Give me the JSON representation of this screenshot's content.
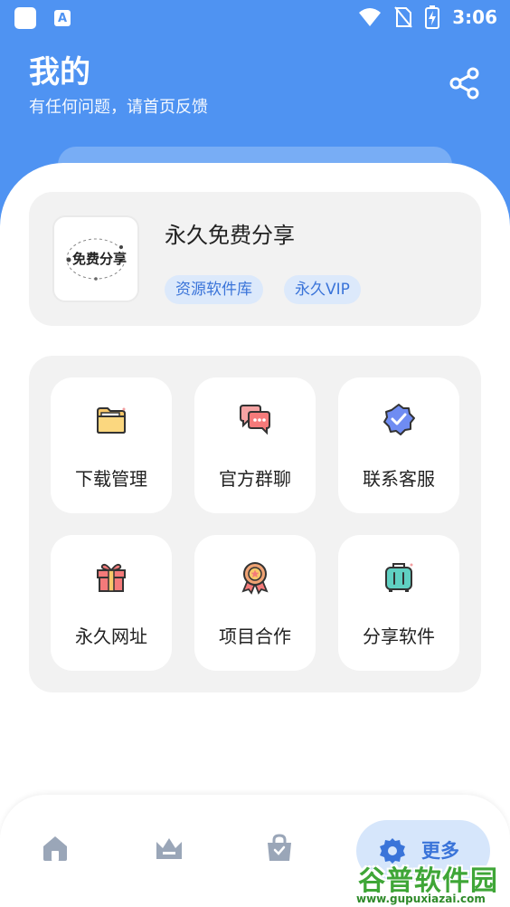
{
  "status_bar": {
    "time": "3:06",
    "notification_letter": "A"
  },
  "header": {
    "title": "我的",
    "subtitle": "有任何问题，请首页反馈",
    "share_icon": "share-icon"
  },
  "profile": {
    "avatar_text": "免费分享",
    "name": "永久免费分享",
    "tags": [
      "资源软件库",
      "永久VIP"
    ]
  },
  "menu": {
    "items": [
      {
        "label": "下载管理",
        "icon": "folder-icon"
      },
      {
        "label": "官方群聊",
        "icon": "chat-bubbles-icon"
      },
      {
        "label": "联系客服",
        "icon": "verified-badge-icon"
      },
      {
        "label": "永久网址",
        "icon": "gift-icon"
      },
      {
        "label": "项目合作",
        "icon": "award-medal-icon"
      },
      {
        "label": "分享软件",
        "icon": "suitcase-icon"
      }
    ]
  },
  "bottom_nav": {
    "items": [
      {
        "icon": "home-icon"
      },
      {
        "icon": "crown-icon"
      },
      {
        "icon": "shopping-bag-icon"
      }
    ],
    "active_label": "更多",
    "active_icon": "gear-icon"
  },
  "watermark": {
    "main": "谷普软件园",
    "url": "www.gupuxiazai.com"
  },
  "colors": {
    "primary": "#4f93f2",
    "tag_text": "#3a74d9",
    "card_bg": "#f2f2f2"
  }
}
